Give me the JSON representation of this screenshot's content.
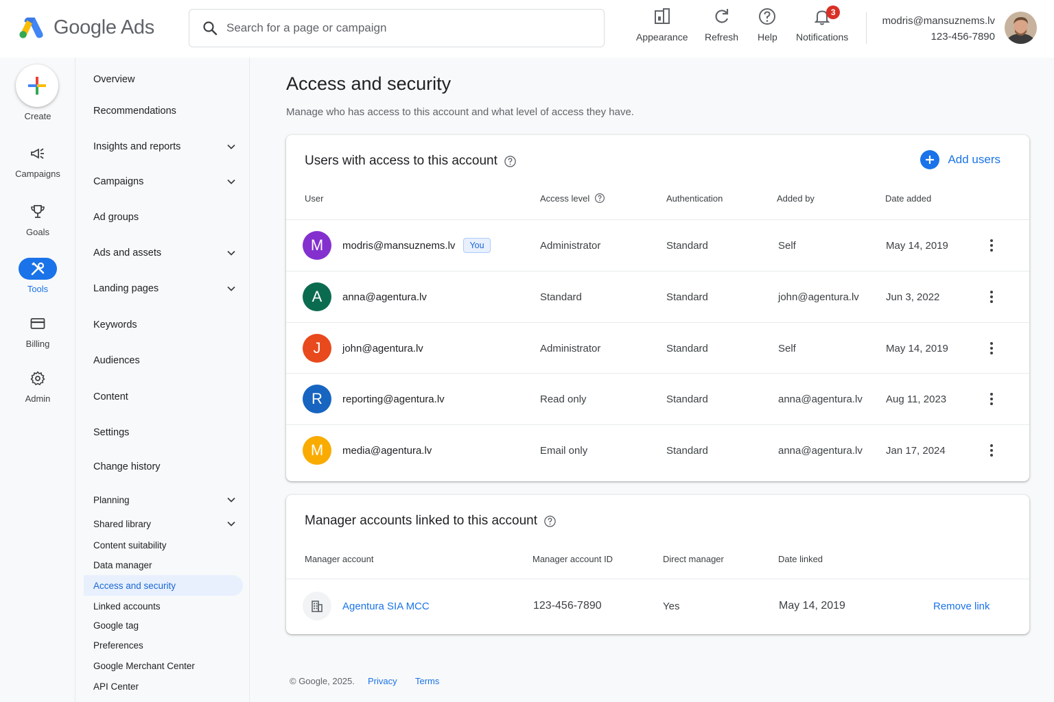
{
  "app": {
    "name": "Google Ads",
    "search_placeholder": "Search for a page or campaign"
  },
  "header": {
    "buttons": [
      {
        "label": "Appearance",
        "icon": "appearance-icon"
      },
      {
        "label": "Refresh",
        "icon": "refresh-icon"
      },
      {
        "label": "Help",
        "icon": "help-icon"
      },
      {
        "label": "Notifications",
        "icon": "bell-icon",
        "badge": "3"
      }
    ],
    "account_email": "modris@mansuznems.lv",
    "account_id": "123-456-7890"
  },
  "rail": {
    "create": "Create",
    "items": [
      {
        "label": "Campaigns",
        "icon": "campaigns-icon"
      },
      {
        "label": "Goals",
        "icon": "trophy-icon"
      },
      {
        "label": "Tools",
        "icon": "tools-icon",
        "active": true
      },
      {
        "label": "Billing",
        "icon": "card-icon"
      },
      {
        "label": "Admin",
        "icon": "gear-icon"
      }
    ]
  },
  "nav": {
    "items": [
      {
        "label": "Overview"
      },
      {
        "label": "Recommendations"
      },
      {
        "label": "Insights and reports",
        "expandable": true
      },
      {
        "label": "Campaigns",
        "expandable": true
      },
      {
        "label": "Ad groups"
      },
      {
        "label": "Ads and assets",
        "expandable": true
      },
      {
        "label": "Landing pages",
        "expandable": true
      },
      {
        "label": "Keywords"
      },
      {
        "label": "Audiences"
      },
      {
        "label": "Content"
      },
      {
        "label": "Settings"
      },
      {
        "label": "Change history"
      },
      {
        "label": "Planning",
        "expandable": true
      },
      {
        "label": "Shared library",
        "expandable": true
      },
      {
        "label": "Content suitability"
      },
      {
        "label": "Data manager"
      },
      {
        "label": "Access and security",
        "active": true
      },
      {
        "label": "Linked accounts"
      },
      {
        "label": "Google tag"
      },
      {
        "label": "Preferences"
      },
      {
        "label": "Google Merchant Center"
      },
      {
        "label": "API Center"
      }
    ]
  },
  "page": {
    "title": "Access and security",
    "subtitle": "Manage who has access to this account and what level of access they have."
  },
  "users_card": {
    "title": "Users with access to this account",
    "add_users": "Add users",
    "columns": [
      "User",
      "Access level",
      "Authentication",
      "Added by",
      "Date added"
    ],
    "rows": [
      {
        "initial": "M",
        "color": "#8430ce",
        "email": "modris@mansuznems.lv",
        "you": "You",
        "access": "Administrator",
        "auth": "Standard",
        "added_by": "Self",
        "date": "May 14, 2019"
      },
      {
        "initial": "A",
        "color": "#0b6b4f",
        "email": "anna@agentura.lv",
        "access": "Standard",
        "auth": "Standard",
        "added_by": "john@agentura.lv",
        "date": "Jun 3, 2022"
      },
      {
        "initial": "J",
        "color": "#e8491d",
        "email": "john@agentura.lv",
        "access": "Administrator",
        "auth": "Standard",
        "added_by": "Self",
        "date": "May 14, 2019"
      },
      {
        "initial": "R",
        "color": "#1765c0",
        "email": "reporting@agentura.lv",
        "access": "Read only",
        "auth": "Standard",
        "added_by": "anna@agentura.lv",
        "date": "Aug 11, 2023"
      },
      {
        "initial": "M",
        "color": "#f9ab00",
        "email": "media@agentura.lv",
        "access": "Email only",
        "auth": "Standard",
        "added_by": "anna@agentura.lv",
        "date": "Jan 17, 2024"
      }
    ]
  },
  "manager_card": {
    "title": "Manager accounts linked to this account",
    "columns": [
      "Manager account",
      "Manager account ID",
      "Direct manager",
      "Date linked"
    ],
    "rows": [
      {
        "name": "Agentura SIA MCC",
        "id": "123-456-7890",
        "direct": "Yes",
        "date": "May 14, 2019",
        "action": "Remove link"
      }
    ]
  },
  "footer": {
    "copyright": "© Google, 2025.",
    "privacy": "Privacy",
    "terms": "Terms"
  }
}
